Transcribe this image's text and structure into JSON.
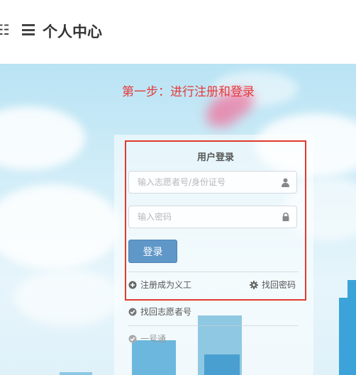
{
  "header": {
    "edge_glyph": "☷",
    "title": "个人中心",
    "menu_icon": "hamburger-icon"
  },
  "annotation": {
    "text": "第一步：进行注册和登录",
    "color": "#e53a3a"
  },
  "login": {
    "title": "用户登录",
    "username_placeholder": "输入志愿者号/身份证号",
    "password_placeholder": "输入密码",
    "submit_label": "登录",
    "register_link": "注册成为义工",
    "forgot_password_link": "找回密码"
  },
  "extra_links": {
    "retrieve_id": "找回志愿者号",
    "one_pass": "一号通"
  },
  "colors": {
    "button": "#5f97c8",
    "highlight_border": "#e03a2e"
  }
}
